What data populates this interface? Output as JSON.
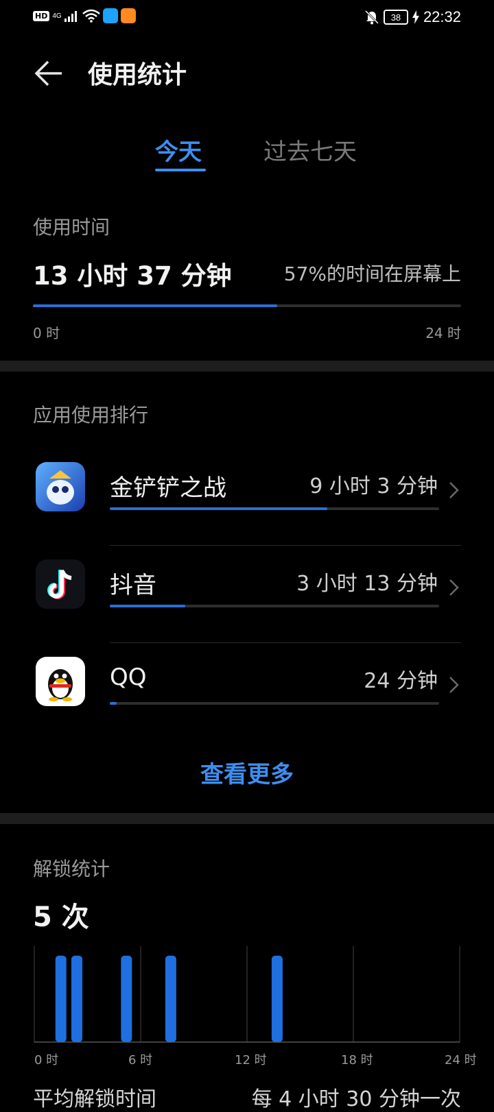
{
  "status_bar": {
    "hd": "HD",
    "network": "4G",
    "time": "22:32",
    "battery": "38"
  },
  "header": {
    "title": "使用统计"
  },
  "tabs": [
    {
      "label": "今天",
      "active": true
    },
    {
      "label": "过去七天",
      "active": false
    }
  ],
  "usage": {
    "section_label": "使用时间",
    "total": "13 小时 37 分钟",
    "screen_ratio_text": "57%的时间在屏幕上",
    "progress_fraction": 0.57,
    "axis_start": "0 时",
    "axis_end": "24 时"
  },
  "ranking": {
    "section_label": "应用使用排行",
    "apps": [
      {
        "name": "金铲铲之战",
        "time": "9 小时 3 分钟",
        "fraction": 0.66,
        "icon": "game-icon"
      },
      {
        "name": "抖音",
        "time": "3 小时 13 分钟",
        "fraction": 0.23,
        "icon": "tiktok-icon"
      },
      {
        "name": "QQ",
        "time": "24 分钟",
        "fraction": 0.02,
        "icon": "qq-penguin-icon"
      }
    ],
    "more_label": "查看更多"
  },
  "unlock": {
    "section_label": "解锁统计",
    "count": "5 次",
    "ticks": [
      "0 时",
      "6 时",
      "12 时",
      "18 时",
      "24 时"
    ],
    "bottom_left": "平均解锁时间",
    "bottom_right": "每 4 小时 30 分钟一次"
  },
  "chart_data": {
    "type": "bar",
    "title": "",
    "xlabel": "",
    "ylabel": "",
    "xlim": [
      0,
      24
    ],
    "x": [
      1.5,
      2.4,
      5.2,
      7.7,
      13.7
    ],
    "values": [
      1,
      1,
      1,
      1,
      1
    ],
    "x_ticks": [
      "0 时",
      "6 时",
      "12 时",
      "18 时",
      "24 时"
    ],
    "grid": true,
    "color": "#1f6fe0"
  },
  "colors": {
    "accent": "#3e8ef1",
    "bar": "#2a6fd6",
    "background": "#000000"
  }
}
